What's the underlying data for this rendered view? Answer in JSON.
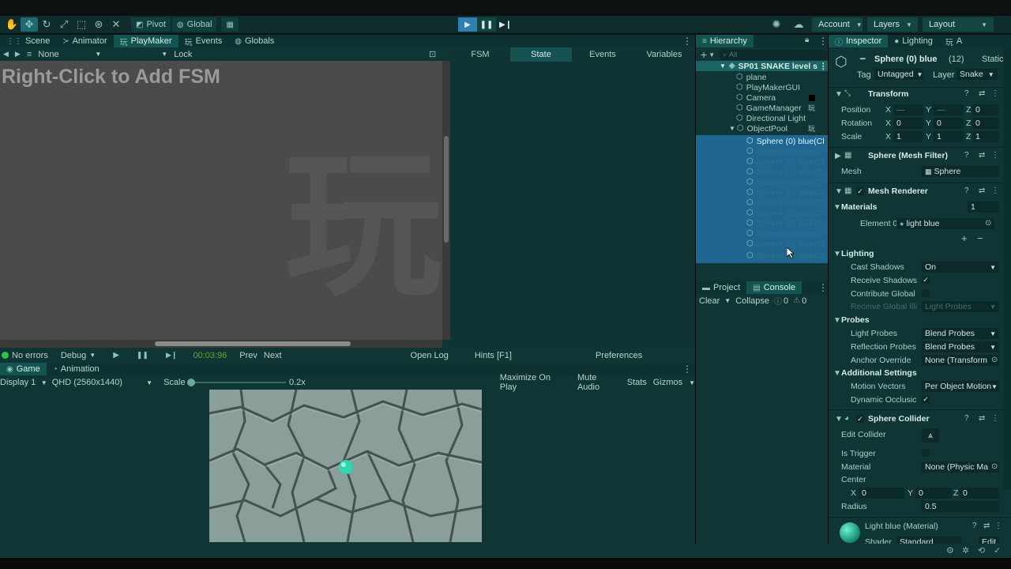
{
  "toolbar": {
    "pivot": "Pivot",
    "global": "Global",
    "account": "Account",
    "layers": "Layers",
    "layout": "Layout"
  },
  "scene_tabs": [
    "Scene",
    "Animator",
    "PlayMaker",
    "Events",
    "Globals"
  ],
  "playmaker": {
    "fsm_select": "None",
    "lock": "Lock",
    "canvas_hint": "Right-Click to Add FSM",
    "watermark": "玩",
    "tabs": [
      "FSM",
      "State",
      "Events",
      "Variables"
    ],
    "selected_tab": "State",
    "status": {
      "errors": "No errors",
      "debug": "Debug",
      "time": "00:03:96",
      "prev": "Prev",
      "next": "Next",
      "open_log": "Open Log",
      "hints": "Hints [F1]",
      "preferences": "Preferences"
    }
  },
  "game": {
    "tabs": [
      "Game",
      "Animation"
    ],
    "display": "Display 1",
    "resolution": "QHD (2560x1440)",
    "scale_label": "Scale",
    "scale_value": "0.2x",
    "maximize": "Maximize On Play",
    "mute": "Mute Audio",
    "stats": "Stats",
    "gizmos": "Gizmos"
  },
  "hierarchy": {
    "title": "Hierarchy",
    "search_placeholder": "All",
    "scene": "SP01 SNAKE level s",
    "items": [
      "plane",
      "PlayMakerGUI",
      "Camera",
      "GameManager",
      "Directional Light",
      "ObjectPool"
    ],
    "selected": "Sphere (0) blue(Cl",
    "clone": "Sphere (0) blue(Cl"
  },
  "project": {
    "tabs": [
      "Project",
      "Console"
    ],
    "clear": "Clear",
    "collapse": "Collapse",
    "warn_count": "0",
    "err_count": "0"
  },
  "inspector": {
    "tabs": [
      "Inspector",
      "Lighting"
    ],
    "object_name": "Sphere (0) blue",
    "count": "(12)",
    "static": "Static",
    "tag_label": "Tag",
    "tag": "Untagged",
    "layer_label": "Layer",
    "layer": "Snake",
    "transform": {
      "title": "Transform",
      "position": "Position",
      "rotation": "Rotation",
      "scale": "Scale",
      "pos": [
        "—",
        "—",
        "0"
      ],
      "rot": [
        "0",
        "0",
        "0"
      ],
      "scl": [
        "1",
        "1",
        "1"
      ]
    },
    "mesh_filter": {
      "title": "Sphere (Mesh Filter)",
      "mesh_label": "Mesh",
      "mesh": "Sphere"
    },
    "mesh_renderer": {
      "title": "Mesh Renderer",
      "materials": "Materials",
      "materials_count": "1",
      "element_label": "Element 0",
      "element_value": "light blue",
      "lighting": "Lighting",
      "cast_shadows_label": "Cast Shadows",
      "cast_shadows": "On",
      "receive_shadows": "Receive Shadows",
      "contribute_gi": "Contribute Global",
      "receive_gi_label": "Receive Global Illi",
      "receive_gi": "Light Probes",
      "probes": "Probes",
      "light_probes_label": "Light Probes",
      "light_probes": "Blend Probes",
      "reflection_label": "Reflection Probes",
      "reflection": "Blend Probes",
      "anchor_label": "Anchor Override",
      "anchor": "None (Transform",
      "additional": "Additional Settings",
      "motion_label": "Motion Vectors",
      "motion": "Per Object Motion",
      "occlusion": "Dynamic Occlusic"
    },
    "collider": {
      "title": "Sphere Collider",
      "edit": "Edit Collider",
      "trigger": "Is Trigger",
      "material_label": "Material",
      "material": "None (Physic Ma",
      "center": "Center",
      "cx": "0",
      "cy": "0",
      "cz": "0",
      "radius_label": "Radius",
      "radius": "0.5"
    },
    "material": {
      "title": "Light blue (Material)",
      "shader_label": "Shader",
      "shader": "Standard",
      "edit": "Edit..."
    }
  }
}
